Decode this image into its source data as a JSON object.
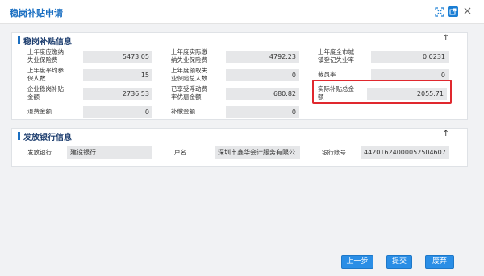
{
  "window": {
    "title": "稳岗补贴申请",
    "icons": [
      "fullscreen-icon",
      "popout-icon",
      "close-icon"
    ],
    "close_glyph": "×"
  },
  "accent_color": "#1a6fc2",
  "section_subsidy": {
    "title": "稳岗补贴信息",
    "toggle": "↑",
    "fields": [
      {
        "label": "上年度应缴纳\n失业保险费",
        "value": "5473.05"
      },
      {
        "label": "上年度实际缴\n纳失业保险费",
        "value": "4792.23"
      },
      {
        "label": "上年度全市城\n镇登记失业率",
        "value": "0.0231"
      },
      {
        "label": "上年度平均参\n保人数",
        "value": "15"
      },
      {
        "label": "上年度领取失\n业保险总人数",
        "value": "0"
      },
      {
        "label": "裁员率",
        "value": "0"
      },
      {
        "label": "企业稳岗补贴\n金额",
        "value": "2736.53"
      },
      {
        "label": "已享受浮动费\n率优惠金额",
        "value": "680.82"
      },
      {
        "label": "实际补贴总金\n额",
        "value": "2055.71"
      },
      {
        "label": "退费金额",
        "value": "0"
      },
      {
        "label": "补缴金额",
        "value": "0"
      }
    ]
  },
  "section_bank": {
    "title": "发放银行信息",
    "toggle": "↑",
    "fields": [
      {
        "label": "发放银行",
        "value": "建设银行"
      },
      {
        "label": "户名",
        "value": "深圳市鑫华会计服务有限公..."
      },
      {
        "label": "银行账号",
        "value": "44201624000052504607"
      }
    ]
  },
  "buttons": {
    "prev": "上一步",
    "submit": "提交",
    "cancel": "废弃"
  }
}
